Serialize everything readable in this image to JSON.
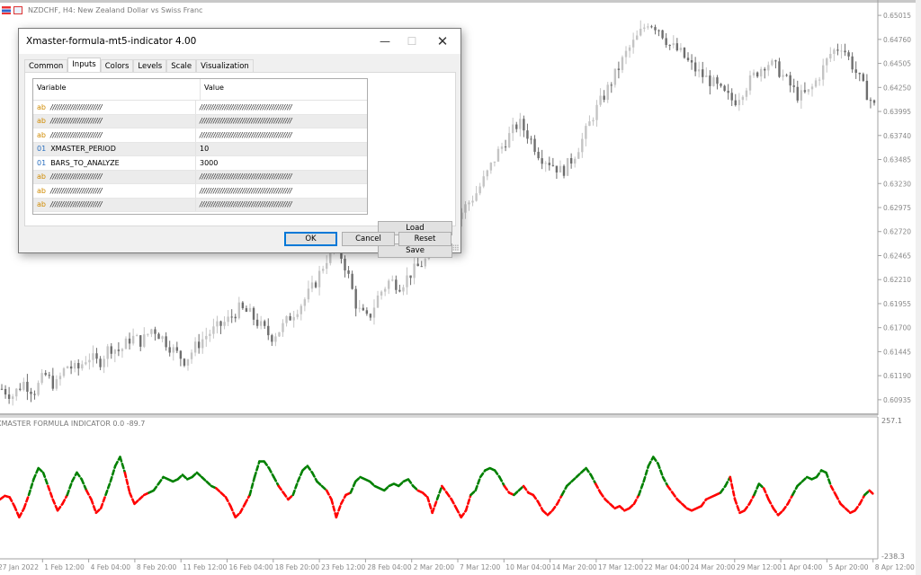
{
  "chart_window": {
    "title": "NZDCHF, H4:  New Zealand Dollar vs Swiss Franc",
    "symbol": "NZDCHF",
    "timeframe": "H4",
    "description": "New Zealand Dollar vs Swiss Franc"
  },
  "dialog": {
    "title": "Xmaster-formula-mt5-indicator 4.00",
    "window_buttons": {
      "minimize": "—",
      "maximize": "☐",
      "close": "✕"
    },
    "tabs": [
      {
        "label": "Common",
        "active": false
      },
      {
        "label": "Inputs",
        "active": true
      },
      {
        "label": "Colors",
        "active": false
      },
      {
        "label": "Levels",
        "active": false
      },
      {
        "label": "Scale",
        "active": false
      },
      {
        "label": "Visualization",
        "active": false
      }
    ],
    "grid": {
      "headers": {
        "variable": "Variable",
        "value": "Value"
      },
      "rows": [
        {
          "type": "ab",
          "variable": "///////////////////////",
          "value": "/////////////////////////////////////////"
        },
        {
          "type": "ab",
          "variable": "///////////////////////",
          "value": "/////////////////////////////////////////"
        },
        {
          "type": "ab",
          "variable": "///////////////////////",
          "value": "/////////////////////////////////////////"
        },
        {
          "type": "01",
          "variable": "XMASTER_PERIOD",
          "value": "10"
        },
        {
          "type": "01",
          "variable": "BARS_TO_ANALYZE",
          "value": "3000"
        },
        {
          "type": "ab",
          "variable": "///////////////////////",
          "value": "/////////////////////////////////////////"
        },
        {
          "type": "ab",
          "variable": "///////////////////////",
          "value": "/////////////////////////////////////////"
        },
        {
          "type": "ab",
          "variable": "///////////////////////",
          "value": "/////////////////////////////////////////"
        }
      ]
    },
    "buttons": {
      "load": "Load",
      "save": "Save",
      "ok": "OK",
      "cancel": "Cancel",
      "reset": "Reset"
    }
  },
  "chart_data": [
    {
      "type": "candlestick",
      "title": "NZDCHF, H4",
      "ylim": [
        0.6081,
        0.6514
      ],
      "y_ticks": [
        "0.65015",
        "0.64760",
        "0.64505",
        "0.64250",
        "0.63995",
        "0.63740",
        "0.63485",
        "0.63230",
        "0.62975",
        "0.62720",
        "0.62465",
        "0.62210",
        "0.61955",
        "0.61700",
        "0.61445",
        "0.61190",
        "0.60935"
      ],
      "y_tick_values": [
        0.65015,
        0.6476,
        0.64505,
        0.6425,
        0.63995,
        0.6374,
        0.63485,
        0.6323,
        0.62975,
        0.6272,
        0.62465,
        0.6221,
        0.61955,
        0.617,
        0.61445,
        0.6119,
        0.60935
      ],
      "trend_closes": [
        0.6105,
        0.6098,
        0.6112,
        0.6102,
        0.612,
        0.6108,
        0.613,
        0.6125,
        0.614,
        0.6132,
        0.615,
        0.6145,
        0.616,
        0.6155,
        0.617,
        0.6158,
        0.6145,
        0.6135,
        0.615,
        0.6162,
        0.617,
        0.6178,
        0.619,
        0.6185,
        0.6172,
        0.616,
        0.617,
        0.6185,
        0.6198,
        0.6215,
        0.624,
        0.626,
        0.6232,
        0.619,
        0.6178,
        0.6205,
        0.622,
        0.6215,
        0.6228,
        0.6238,
        0.6248,
        0.6265,
        0.628,
        0.6298,
        0.6312,
        0.6332,
        0.6355,
        0.6372,
        0.6388,
        0.6372,
        0.6352,
        0.6345,
        0.6335,
        0.635,
        0.6372,
        0.6398,
        0.6418,
        0.644,
        0.6462,
        0.6478,
        0.6495,
        0.6488,
        0.647,
        0.6462,
        0.6448,
        0.6438,
        0.643,
        0.6418,
        0.641,
        0.6425,
        0.644,
        0.6452,
        0.6445,
        0.643,
        0.6415,
        0.642,
        0.644,
        0.6462,
        0.647,
        0.6448,
        0.6425,
        0.6405
      ]
    },
    {
      "type": "line",
      "title": "XMASTER FORMULA INDICATOR 0.0 -89.7",
      "ylim": [
        -238.3,
        257.1
      ],
      "y_tick_labels": [
        "257.1",
        "-238.3"
      ],
      "x_tick_labels": [
        "27 Jan 2022",
        "1 Feb 12:00",
        "4 Feb 04:00",
        "8 Feb 20:00",
        "11 Feb 12:00",
        "16 Feb 04:00",
        "18 Feb 20:00",
        "23 Feb 12:00",
        "28 Feb 04:00",
        "2 Mar 20:00",
        "7 Mar 12:00",
        "10 Mar 04:00",
        "14 Mar 20:00",
        "17 Mar 12:00",
        "22 Mar 04:00",
        "24 Mar 20:00",
        "29 Mar 12:00",
        "1 Apr 04:00",
        "5 Apr 20:00",
        "8 Apr 12:00"
      ],
      "series": [
        {
          "name": "rising",
          "color": "#008000",
          "style": "dashed"
        },
        {
          "name": "falling",
          "color": "#ff0000",
          "style": "dashed"
        }
      ],
      "values": [
        -20,
        -12,
        -15,
        -35,
        -60,
        -40,
        -10,
        25,
        50,
        40,
        10,
        -20,
        -45,
        -30,
        -10,
        20,
        40,
        25,
        0,
        -20,
        -50,
        -40,
        -10,
        20,
        55,
        75,
        40,
        -5,
        -30,
        -20,
        -10,
        -5,
        0,
        15,
        30,
        25,
        20,
        25,
        35,
        25,
        30,
        40,
        30,
        20,
        10,
        5,
        -5,
        -15,
        -35,
        -60,
        -50,
        -30,
        -10,
        30,
        65,
        65,
        50,
        30,
        10,
        -5,
        -20,
        -10,
        20,
        45,
        55,
        40,
        20,
        10,
        0,
        -20,
        -60,
        -30,
        -10,
        -5,
        20,
        30,
        25,
        20,
        10,
        5,
        0,
        10,
        15,
        10,
        20,
        25,
        10,
        0,
        -5,
        -15,
        -50,
        -20,
        10,
        -5,
        -20,
        -40,
        -60,
        -45,
        -10,
        0,
        30,
        45,
        50,
        45,
        30,
        10,
        -5,
        -10,
        0,
        10,
        -5,
        -10,
        -25,
        -45,
        -55,
        -45,
        -30,
        -10,
        10,
        20,
        30,
        40,
        50,
        35,
        15,
        -5,
        -20,
        -30,
        -40,
        -35,
        -45,
        -40,
        -30,
        -10,
        20,
        55,
        75,
        60,
        30,
        10,
        -5,
        -20,
        -30,
        -40,
        -45,
        -40,
        -35,
        -20,
        -15,
        -10,
        -5,
        10,
        30,
        -20,
        -50,
        -45,
        -30,
        -10,
        15,
        5,
        -20,
        -40,
        -55,
        -45,
        -30,
        -10,
        10,
        20,
        30,
        25,
        30,
        45,
        40,
        10,
        -10,
        -30,
        -40,
        -50,
        -45,
        -30,
        -10,
        0,
        -10
      ]
    }
  ]
}
